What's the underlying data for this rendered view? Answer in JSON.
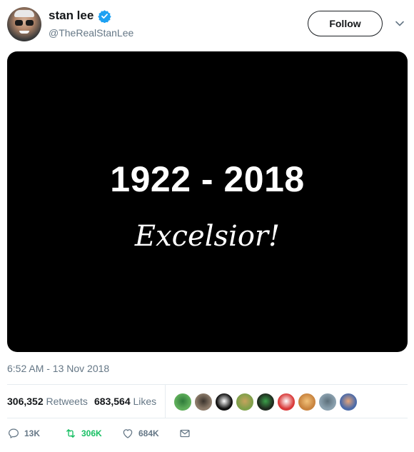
{
  "author": {
    "display_name": "stan lee",
    "handle": "@TheRealStanLee",
    "verified": true
  },
  "follow_button": {
    "label": "Follow"
  },
  "caret_icon": "chevron-down-icon",
  "media": {
    "years": "1922 - 2018",
    "motto": "Excelsior!"
  },
  "timestamp": "6:52 AM - 13 Nov 2018",
  "stats": {
    "retweets_count": "306,352",
    "retweets_label": "Retweets",
    "likes_count": "683,564",
    "likes_label": "Likes"
  },
  "likers": [
    {
      "color": "#5fae5a",
      "accent": "#2e7a3a"
    },
    {
      "color": "#8c7b6a",
      "accent": "#3a332c"
    },
    {
      "color": "#111111",
      "accent": "#ffffff"
    },
    {
      "color": "#7fa04a",
      "accent": "#c7a25d"
    },
    {
      "color": "#1f2b1f",
      "accent": "#3ba04a"
    },
    {
      "color": "#d93a3a",
      "accent": "#ffffff"
    },
    {
      "color": "#c9843f",
      "accent": "#f2c27a"
    },
    {
      "color": "#8aa0ae",
      "accent": "#5c6f7a"
    },
    {
      "color": "#4b6aa8",
      "accent": "#e5a57a"
    }
  ],
  "actions": {
    "reply": {
      "icon": "reply-icon",
      "count": "13K"
    },
    "retweet": {
      "icon": "retweet-icon",
      "count": "306K",
      "active_color": "#17bf63"
    },
    "like": {
      "icon": "heart-icon",
      "count": "684K"
    },
    "dm": {
      "icon": "envelope-icon"
    }
  },
  "colors": {
    "verified_blue": "#1da1f2",
    "muted_text": "#657786",
    "primary_text": "#14171a",
    "divider": "#e6ecf0"
  }
}
